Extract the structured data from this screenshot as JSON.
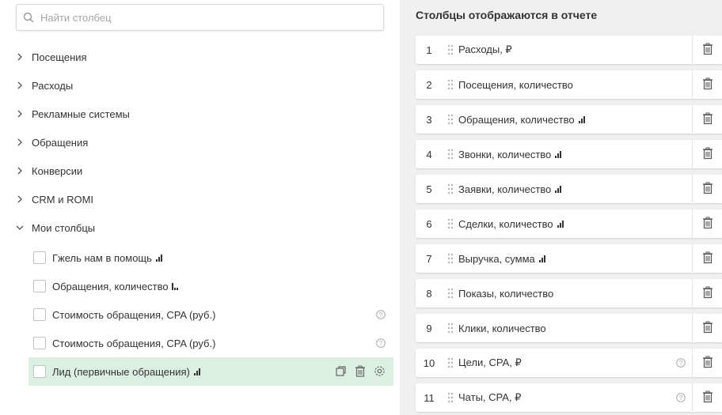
{
  "search": {
    "placeholder": "Найти столбец",
    "value": ""
  },
  "groups": [
    {
      "label": "Посещения",
      "expanded": false
    },
    {
      "label": "Расходы",
      "expanded": false
    },
    {
      "label": "Рекламные системы",
      "expanded": false
    },
    {
      "label": "Обращения",
      "expanded": false
    },
    {
      "label": "Конверсии",
      "expanded": false
    },
    {
      "label": "CRM и ROMI",
      "expanded": false
    },
    {
      "label": "Мои столбцы",
      "expanded": true
    }
  ],
  "my_columns": [
    {
      "label": "Гжель нам в помощь",
      "checked": false,
      "icon": "bar-chart-icon"
    },
    {
      "label": "Обращения, количество",
      "checked": false,
      "icon": "bar-chart-icon"
    },
    {
      "label": "Стоимость обращения, CPA (руб.)",
      "checked": false,
      "icon": "help-icon"
    },
    {
      "label": "Стоимость обращения, CPA (руб.)",
      "checked": false,
      "icon": "help-icon"
    },
    {
      "label": "Лид (первичные обращения)",
      "checked": false,
      "icon": "bar-chart-icon",
      "selected": true
    }
  ],
  "right": {
    "title": "Столбцы отображаются в отчете",
    "rows": [
      {
        "num": "1",
        "label": "Расходы, ₽",
        "icon": ""
      },
      {
        "num": "2",
        "label": "Посещения, количество",
        "icon": ""
      },
      {
        "num": "3",
        "label": "Обращения, количество",
        "icon": "bar-chart-icon"
      },
      {
        "num": "4",
        "label": "Звонки, количество",
        "icon": "bar-chart-icon"
      },
      {
        "num": "5",
        "label": "Заявки, количество",
        "icon": "bar-chart-icon"
      },
      {
        "num": "6",
        "label": "Сделки, количество",
        "icon": "bar-chart-icon"
      },
      {
        "num": "7",
        "label": "Выручка, сумма",
        "icon": "bar-chart-icon"
      },
      {
        "num": "8",
        "label": "Показы, количество",
        "icon": ""
      },
      {
        "num": "9",
        "label": "Клики, количество",
        "icon": ""
      },
      {
        "num": "10",
        "label": "Цели, CPA, ₽",
        "icon": "help-icon"
      },
      {
        "num": "11",
        "label": "Чаты, CPA, ₽",
        "icon": "help-icon"
      }
    ]
  },
  "colors": {
    "selected_bg": "#dcefe3",
    "right_bg": "#f0f0f0",
    "text": "#333333"
  }
}
